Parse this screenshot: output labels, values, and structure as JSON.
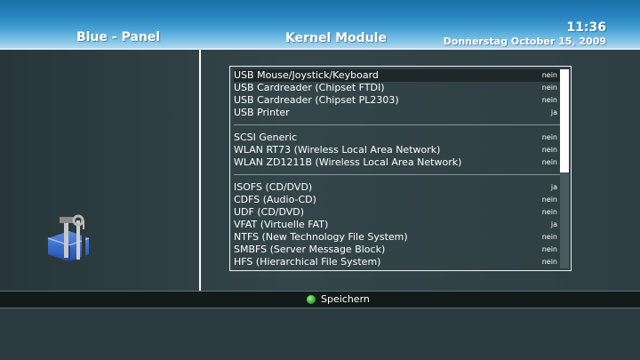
{
  "header": {
    "panel_title": "Blue - Panel",
    "screen_title": "Kernel Module",
    "time": "11:36",
    "date": "Donnerstag October 15, 2009"
  },
  "modules": {
    "groups": [
      [
        {
          "label": "USB Mouse/Joystick/Keyboard",
          "status": "nein",
          "selected": true
        },
        {
          "label": "USB Cardreader (Chipset FTDI)",
          "status": "nein"
        },
        {
          "label": "USB Cardreader (Chipset PL2303)",
          "status": "nein"
        },
        {
          "label": "USB Printer",
          "status": "ja"
        }
      ],
      [
        {
          "label": "SCSI Generic",
          "status": "nein"
        },
        {
          "label": "WLAN RT73 (Wireless Local Area Network)",
          "status": "nein"
        },
        {
          "label": "WLAN ZD1211B (Wireless Local Area Network)",
          "status": "nein"
        }
      ],
      [
        {
          "label": "ISOFS (CD/DVD)",
          "status": "ja"
        },
        {
          "label": "CDFS (Audio-CD)",
          "status": "nein"
        },
        {
          "label": "UDF (CD/DVD)",
          "status": "nein"
        },
        {
          "label": "VFAT (Virtuelle FAT)",
          "status": "ja"
        },
        {
          "label": "NTFS (New Technology File System)",
          "status": "nein"
        },
        {
          "label": "SMBFS (Server Message Block)",
          "status": "nein"
        },
        {
          "label": "HFS (Hierarchical File System)",
          "status": "nein"
        }
      ]
    ]
  },
  "footer": {
    "green_button_label": "Speichern",
    "green_color": "#2fa02a"
  },
  "icons": {
    "panel_icon": "tools-icon",
    "green_key": "green-button-icon"
  }
}
